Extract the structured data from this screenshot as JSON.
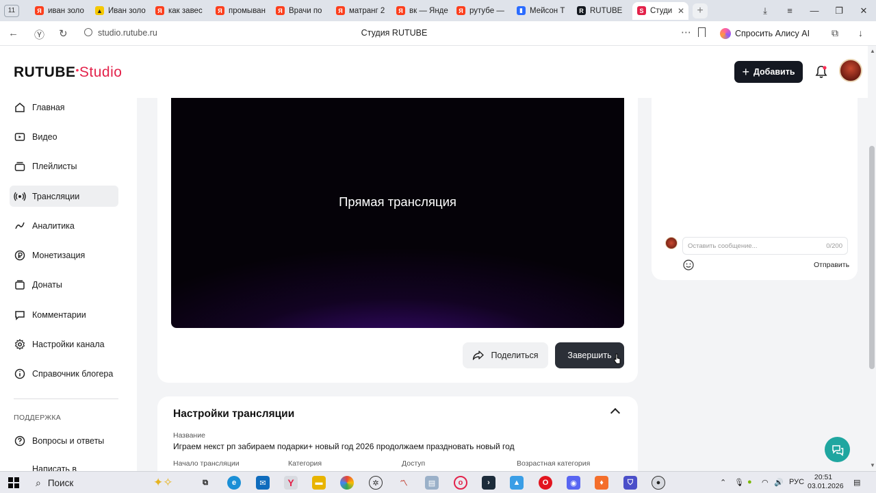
{
  "browser": {
    "tab_count": "11",
    "tabs": [
      {
        "label": "иван золо",
        "favicon": "yandex",
        "color": "#fc3f1d"
      },
      {
        "label": "Иван золо",
        "favicon": "yandex-smile",
        "color": "#f5c800"
      },
      {
        "label": "как завес",
        "favicon": "yandex",
        "color": "#fc3f1d"
      },
      {
        "label": "промыван",
        "favicon": "yandex",
        "color": "#fc3f1d"
      },
      {
        "label": "Врачи по",
        "favicon": "yandex",
        "color": "#fc3f1d"
      },
      {
        "label": "матранг 2",
        "favicon": "yandex",
        "color": "#fc3f1d"
      },
      {
        "label": "вк — Янде",
        "favicon": "yandex",
        "color": "#fc3f1d"
      },
      {
        "label": "рутубе —",
        "favicon": "yandex",
        "color": "#fc3f1d"
      },
      {
        "label": "Мейсон Т",
        "favicon": "app-blue",
        "color": "#2b6cff"
      },
      {
        "label": "RUTUBE",
        "favicon": "rutube",
        "color": "#14191f"
      }
    ],
    "active_tab": {
      "label": "Студи",
      "favicon": "rutube-studio",
      "color": "#e3224a"
    },
    "url": "studio.rutube.ru",
    "page_title": "Студия RUTUBE",
    "alice_label": "Спросить Алису AI"
  },
  "header": {
    "logo_main": "RUTUBE",
    "logo_sub": "Studio",
    "add_button": "Добавить"
  },
  "sidebar": {
    "items": [
      {
        "label": "Главная",
        "icon": "home-icon"
      },
      {
        "label": "Видео",
        "icon": "video-icon"
      },
      {
        "label": "Плейлисты",
        "icon": "playlist-icon"
      },
      {
        "label": "Трансляции",
        "icon": "broadcast-icon",
        "active": true
      },
      {
        "label": "Аналитика",
        "icon": "analytics-icon"
      },
      {
        "label": "Монетизация",
        "icon": "ruble-icon"
      },
      {
        "label": "Донаты",
        "icon": "donate-icon"
      },
      {
        "label": "Комментарии",
        "icon": "comment-icon"
      },
      {
        "label": "Настройки канала",
        "icon": "gear-icon"
      },
      {
        "label": "Справочник блогера",
        "icon": "info-icon"
      }
    ],
    "support_heading": "ПОДДЕРЖКА",
    "support_items": [
      {
        "label": "Вопросы и ответы",
        "icon": "help-icon"
      },
      {
        "label": "Написать в",
        "icon": "mail-icon"
      }
    ]
  },
  "player": {
    "title": "Прямая трансляция"
  },
  "actions": {
    "share": "Поделиться",
    "finish": "Завершить"
  },
  "chat": {
    "placeholder": "Оставить сообщение...",
    "counter": "0/200",
    "send": "Отправить"
  },
  "settings": {
    "title": "Настройки трансляции",
    "name_label": "Название",
    "name_value": "Играем некст рп забираем подарки+ новый год 2026 продолжаем праздновать новый год",
    "start_label": "Начало трансляции",
    "category_label": "Категория",
    "access_label": "Доступ",
    "age_label": "Возрастная категория"
  },
  "taskbar": {
    "search_label": "Поиск",
    "lang": "РУС",
    "time": "20:51",
    "date": "03.01.2026"
  }
}
